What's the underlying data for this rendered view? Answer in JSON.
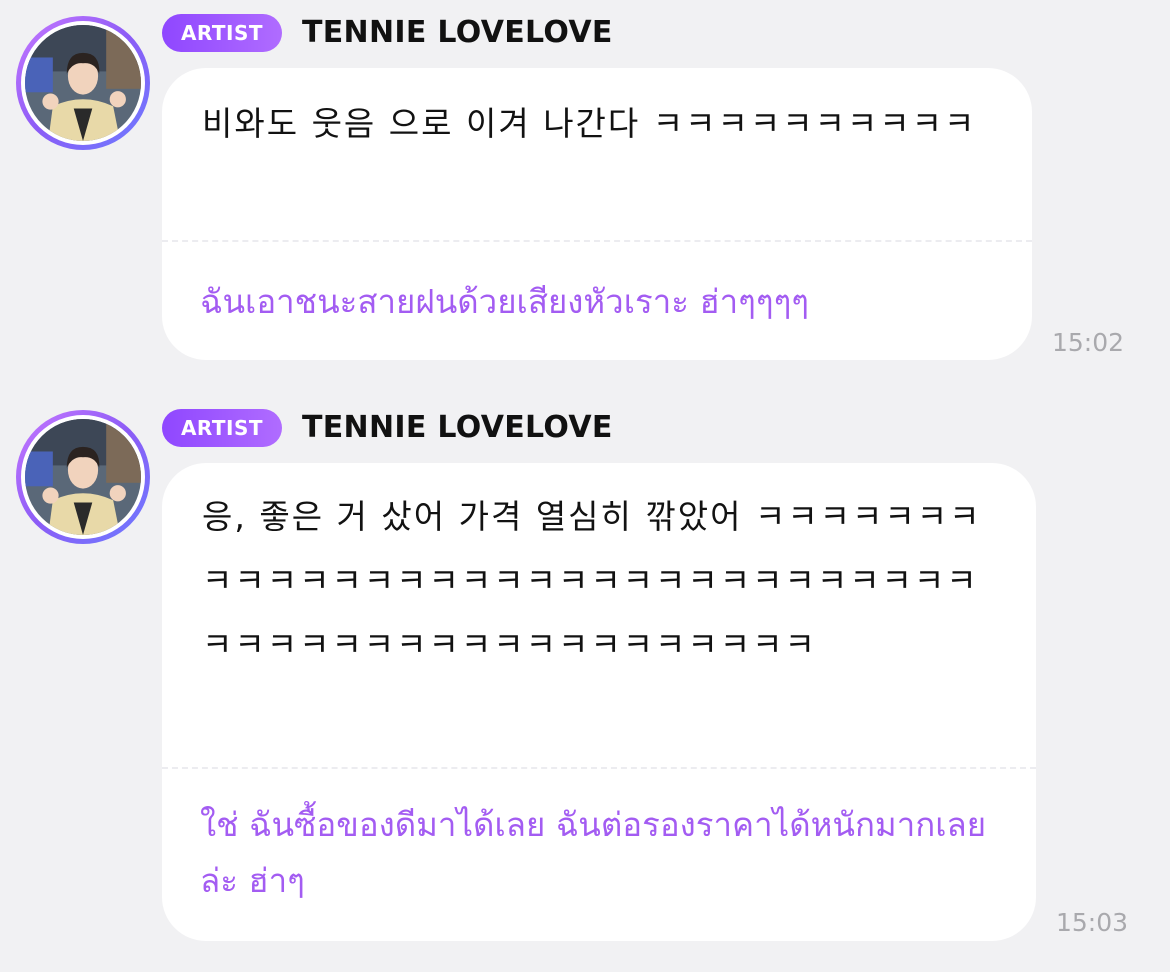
{
  "messages": [
    {
      "badge": "ARTIST",
      "sender": "TENNIE LOVELOVE",
      "original": "비와도 웃음 으로 이겨 나간다 ㅋㅋㅋㅋㅋㅋㅋㅋㅋㅋ",
      "translation": "ฉันเอาชนะสายฝนด้วยเสียงหัวเราะ ฮ่าๆๆๆๆ",
      "time": "15:02"
    },
    {
      "badge": "ARTIST",
      "sender": "TENNIE LOVELOVE",
      "original": "응, 좋은 거 샀어 가격 열심히 깎았어 ㅋㅋㅋㅋㅋㅋㅋㅋㅋㅋㅋㅋㅋㅋㅋㅋㅋㅋㅋㅋㅋㅋㅋㅋㅋㅋㅋㅋㅋㅋㅋㅋㅋㅋㅋㅋㅋㅋㅋㅋㅋㅋㅋㅋㅋㅋㅋㅋㅋㅋ",
      "translation": "ใช่ ฉันซื้อของดีมาได้เลย ฉันต่อรองราคาได้หนักมากเลยล่ะ ฮ่าๆ",
      "time": "15:03"
    }
  ]
}
